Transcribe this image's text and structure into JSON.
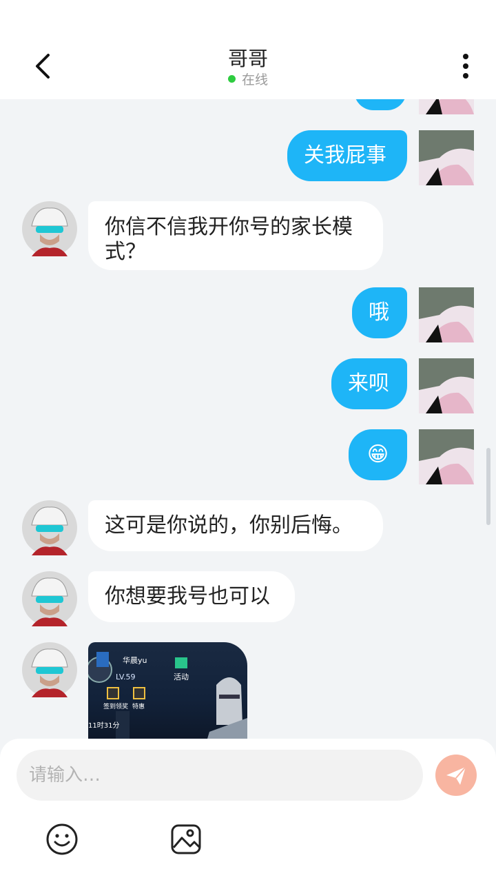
{
  "header": {
    "title": "哥哥",
    "status": "在线"
  },
  "messages": [
    {
      "side": "right",
      "text": "关我屁事"
    },
    {
      "side": "left",
      "text_line1": "你信不信我开你号的家长模",
      "text_line2": "式？"
    },
    {
      "side": "right",
      "text": "哦"
    },
    {
      "side": "right",
      "text": "来呗"
    },
    {
      "side": "right",
      "emoji": "😁"
    },
    {
      "side": "left",
      "text": "这可是你说的，你别后悔。"
    },
    {
      "side": "left",
      "text": "你想要我号也可以"
    },
    {
      "side": "left",
      "image": {
        "name": "华晨yu",
        "level": "LV.59",
        "activity": "活动",
        "checkin": "签到领奖",
        "special": "特惠",
        "time": "11时31分"
      }
    }
  ],
  "composer": {
    "placeholder": "请输入…"
  },
  "colors": {
    "accent": "#1eb5f7",
    "online": "#2ecc40",
    "send": "#f8b5a1"
  },
  "icons": [
    "back-arrow-icon",
    "more-vertical-icon",
    "send-icon",
    "emoji-icon",
    "image-icon"
  ]
}
